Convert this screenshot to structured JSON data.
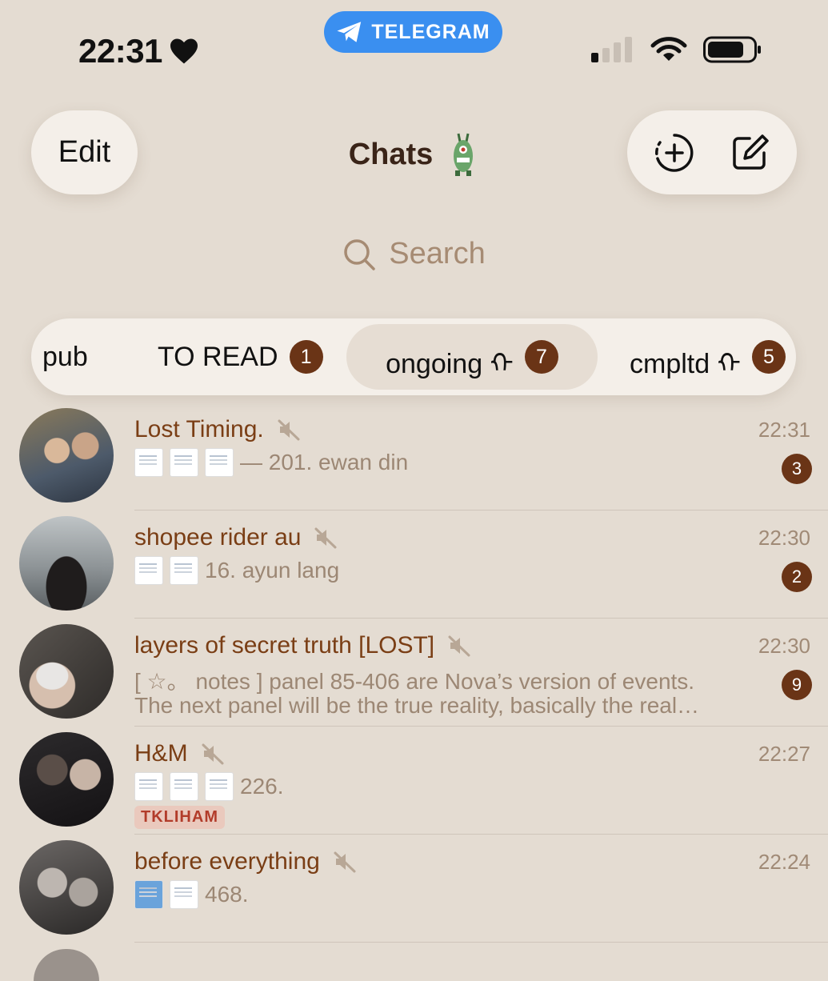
{
  "status_bar": {
    "time": "22:31",
    "app_pill": "TELEGRAM"
  },
  "header": {
    "edit_label": "Edit",
    "title": "Chats"
  },
  "search": {
    "placeholder": "Search"
  },
  "folders": [
    {
      "label": "pub",
      "count": ""
    },
    {
      "label": "TO READ",
      "count": "1"
    },
    {
      "label": "ongoing ᡣ",
      "count": "7",
      "active": true
    },
    {
      "label": "cmpltd ᡣ",
      "count": "5"
    }
  ],
  "chats": [
    {
      "name": "Lost Timing.",
      "time": "22:31",
      "preview": "— 201. ewan din",
      "preview2": "",
      "unread": "3",
      "tag": "",
      "muted": true
    },
    {
      "name": "shopee rider au",
      "time": "22:30",
      "preview": "16. ayun lang",
      "preview2": "",
      "unread": "2",
      "tag": "",
      "muted": true
    },
    {
      "name": "layers of secret truth [LOST]",
      "time": "22:30",
      "preview": "[ ☆。 notes ] panel 85-406 are Nova’s version of events.",
      "preview2": "The next panel will be the true reality, basically the real…",
      "unread": "9",
      "tag": "",
      "muted": true
    },
    {
      "name": "H&M",
      "time": "22:27",
      "preview": "226.",
      "preview2": "",
      "unread": "",
      "tag": "TKLIHAM",
      "muted": true
    },
    {
      "name": "before everything",
      "time": "22:24",
      "preview": "468.",
      "preview2": "",
      "unread": "",
      "tag": "",
      "muted": true
    }
  ],
  "colors": {
    "background": "#e4dcd2",
    "accent": "#6a3416",
    "chat_name": "#7a3e15",
    "telegram_blue": "#3a8ff0"
  }
}
